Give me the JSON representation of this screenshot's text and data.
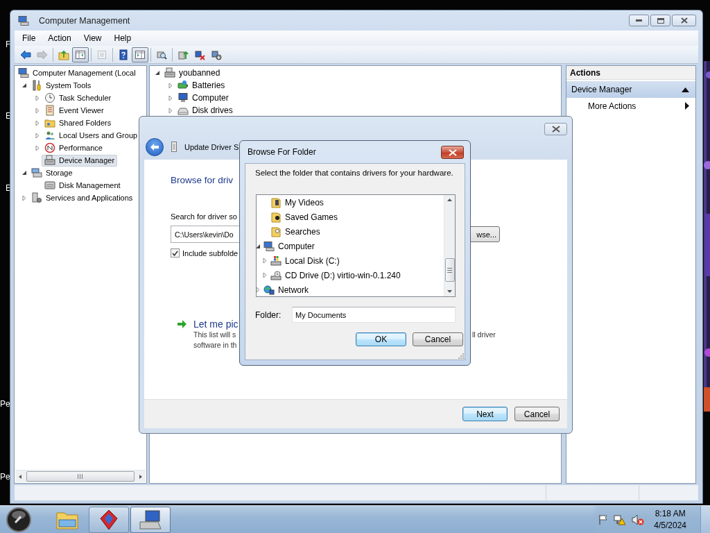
{
  "desktop_labels": [
    "F",
    "E",
    "E",
    "Pe",
    "Pe"
  ],
  "main_window": {
    "title": "Computer Management",
    "menu": [
      "File",
      "Action",
      "View",
      "Help"
    ],
    "toolbar": [
      {
        "kind": "back",
        "pressed": false,
        "disabled": false
      },
      {
        "kind": "forward",
        "pressed": false,
        "disabled": true
      },
      {
        "kind": "separator"
      },
      {
        "kind": "up",
        "pressed": false,
        "disabled": false
      },
      {
        "kind": "console-tree",
        "pressed": true,
        "disabled": false
      },
      {
        "kind": "separator"
      },
      {
        "kind": "properties",
        "pressed": false,
        "disabled": true
      },
      {
        "kind": "separator"
      },
      {
        "kind": "help",
        "pressed": false,
        "disabled": false
      },
      {
        "kind": "action-pane",
        "pressed": true,
        "disabled": false
      },
      {
        "kind": "separator"
      },
      {
        "kind": "scan",
        "pressed": false,
        "disabled": false
      },
      {
        "kind": "separator"
      },
      {
        "kind": "update",
        "pressed": false,
        "disabled": false
      },
      {
        "kind": "uninstall",
        "pressed": false,
        "disabled": false
      },
      {
        "kind": "disable",
        "pressed": false,
        "disabled": false
      }
    ],
    "console_tree": [
      {
        "label": "Computer Management (Local",
        "kind": "computer",
        "selected": false,
        "children": [
          {
            "label": "System Tools",
            "kind": "tools",
            "expanded": true,
            "selected": false,
            "children": [
              {
                "label": "Task Scheduler",
                "kind": "clock",
                "expanded": false,
                "selected": false
              },
              {
                "label": "Event Viewer",
                "kind": "log",
                "expanded": false,
                "selected": false
              },
              {
                "label": "Shared Folders",
                "kind": "shared-folder",
                "expanded": false,
                "selected": false
              },
              {
                "label": "Local Users and Group",
                "kind": "users",
                "expanded": false,
                "selected": false
              },
              {
                "label": "Performance",
                "kind": "performance",
                "expanded": false,
                "selected": false
              },
              {
                "label": "Device Manager",
                "kind": "device",
                "selected": true
              }
            ]
          },
          {
            "label": "Storage",
            "kind": "storage",
            "expanded": true,
            "selected": false,
            "children": [
              {
                "label": "Disk Management",
                "kind": "disk",
                "selected": false
              }
            ]
          },
          {
            "label": "Services and Applications",
            "kind": "services",
            "expanded": false,
            "selected": false
          }
        ]
      }
    ],
    "device_tree": [
      {
        "label": "youbanned",
        "kind": "device",
        "expanded": true,
        "children": [
          {
            "label": "Batteries",
            "kind": "battery",
            "expanded": false
          },
          {
            "label": "Computer",
            "kind": "monitor",
            "expanded": false
          },
          {
            "label": "Disk drives",
            "kind": "drive",
            "expanded": false
          }
        ]
      }
    ],
    "actions": {
      "header": "Actions",
      "section": {
        "label": "Device Manager",
        "expanded": true
      },
      "items": [
        "More Actions"
      ]
    }
  },
  "update_driver_dialog": {
    "title": "Update Driver S",
    "heading": "Browse for driv",
    "search_label": "Search for driver so",
    "path": "C:\\Users\\kevin\\Do",
    "browse_button": "wse...",
    "include_subfolders": {
      "label": "Include subfolde",
      "checked": true
    },
    "pick_link": "Let me pic",
    "description": [
      "This list will s",
      "software in th"
    ],
    "description_tail": "ll driver",
    "buttons": [
      {
        "label": "Next",
        "default": true
      },
      {
        "label": "Cancel",
        "default": false
      }
    ]
  },
  "browse_dialog": {
    "title": "Browse For Folder",
    "instruction": "Select the folder that contains drivers for your hardware.",
    "tree": [
      {
        "children": [
          {
            "label": "My Videos",
            "kind": "video-folder"
          },
          {
            "label": "Saved Games",
            "kind": "games-folder"
          },
          {
            "label": "Searches",
            "kind": "search-folder"
          }
        ]
      },
      {
        "label": "Computer",
        "kind": "computer",
        "expanded": true,
        "children": [
          {
            "label": "Local Disk (C:)",
            "kind": "local-disk",
            "expanded": false
          },
          {
            "label": "CD Drive (D:) virtio-win-0.1.240",
            "kind": "cd-drive",
            "expanded": false
          }
        ]
      },
      {
        "label": "Network",
        "kind": "network",
        "expanded": false
      }
    ],
    "folder_label": "Folder:",
    "folder_value": "My Documents",
    "buttons": [
      {
        "label": "OK",
        "default": true
      },
      {
        "label": "Cancel",
        "default": false
      }
    ]
  },
  "taskbar": {
    "items": [
      {
        "kind": "explorer",
        "running": false,
        "selected": false
      },
      {
        "kind": "app",
        "running": true,
        "selected": false
      },
      {
        "kind": "computer-management",
        "running": true,
        "selected": true
      }
    ],
    "time": "8:18 AM",
    "date": "4/5/2024"
  }
}
